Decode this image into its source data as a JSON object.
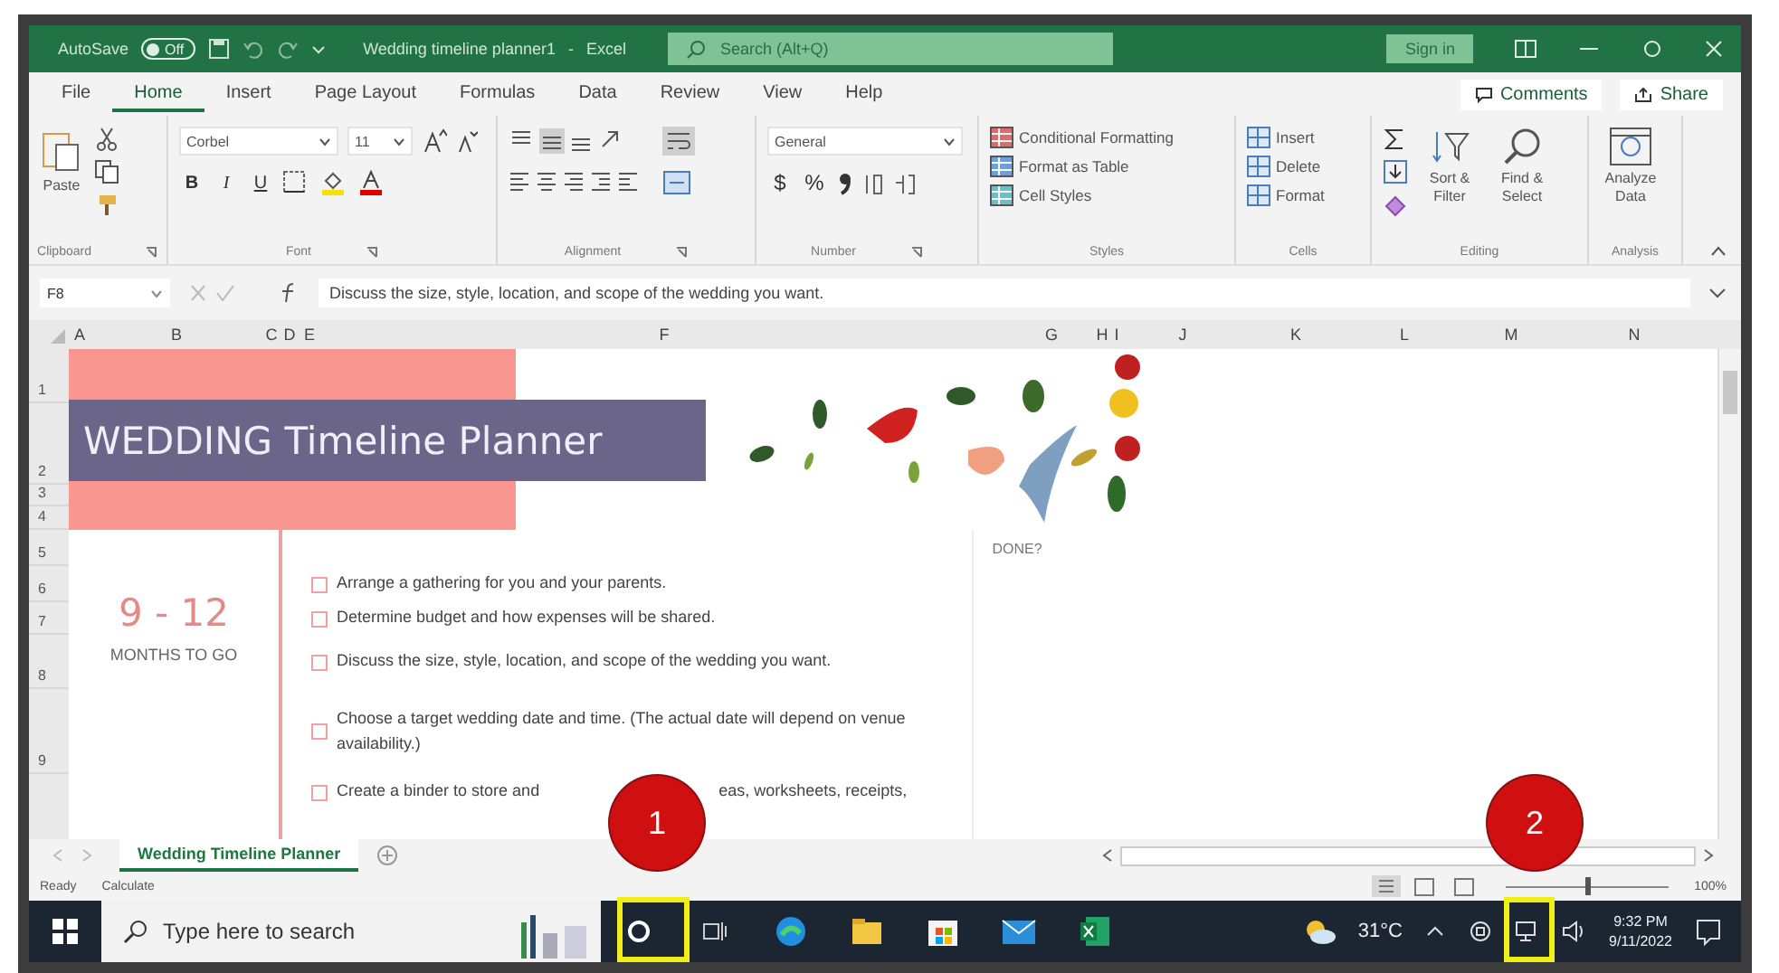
{
  "title_bar": {
    "autosave": {
      "label": "AutoSave",
      "on": false,
      "state_text": "Off"
    },
    "document_title": "Wedding timeline planner1",
    "separator": "-",
    "app_name": "Excel",
    "search_placeholder": "Search (Alt+Q)",
    "sign_in": "Sign in"
  },
  "ribbon_tabs": [
    {
      "label": "File",
      "selected": false
    },
    {
      "label": "Home",
      "selected": true
    },
    {
      "label": "Insert",
      "selected": false
    },
    {
      "label": "Page Layout",
      "selected": false
    },
    {
      "label": "Formulas",
      "selected": false
    },
    {
      "label": "Data",
      "selected": false
    },
    {
      "label": "Review",
      "selected": false
    },
    {
      "label": "View",
      "selected": false
    },
    {
      "label": "Help",
      "selected": false
    }
  ],
  "comments": "Comments",
  "share": "Share",
  "ribbon": {
    "clipboard": {
      "paste": "Paste",
      "group": "Clipboard"
    },
    "font": {
      "name": "Corbel",
      "size": "11",
      "bold": "B",
      "italic": "I",
      "underline": "U",
      "group": "Font"
    },
    "alignment": {
      "group": "Alignment"
    },
    "number": {
      "format": "General",
      "currency": "$",
      "percent": "%",
      "group": "Number"
    },
    "styles": {
      "items": [
        "Conditional Formatting",
        "Format as Table",
        "Cell Styles"
      ],
      "group": "Styles"
    },
    "cells": {
      "items": [
        "Insert",
        "Delete",
        "Format"
      ],
      "group": "Cells"
    },
    "editing": {
      "sort": "Sort & Filter",
      "find": "Find & Select",
      "group": "Editing"
    },
    "analysis": {
      "button": "Analyze Data",
      "group": "Analysis"
    }
  },
  "formula_bar": {
    "name_box": "F8",
    "formula": "Discuss the size, style, location, and scope of the wedding you want."
  },
  "sheet": {
    "columns": [
      "A",
      "B",
      "C",
      "D",
      "E",
      "F",
      "G",
      "H",
      "I",
      "J",
      "K",
      "L",
      "M",
      "N"
    ],
    "row_numbers": [
      "1",
      "2",
      "3",
      "4",
      "5",
      "6",
      "7",
      "8",
      "9"
    ],
    "title": "WEDDING Timeline Planner",
    "period": "9 - 12",
    "period_label": "MONTHS TO GO",
    "done_header": "DONE?",
    "tasks": [
      {
        "parts": [
          "Arrange a gathering for you and your parents."
        ],
        "checked": false
      },
      {
        "parts": [
          "Determine budget and how expenses will be shared."
        ],
        "checked": false
      },
      {
        "parts": [
          "Discuss the size, style, location, and scope of the wedding you want."
        ],
        "checked": false
      },
      {
        "parts": [
          "Choose a target wedding date and time. (The actual date will depend on venue availability.)"
        ],
        "checked": false
      },
      {
        "parts": [
          "Create a binder to store and",
          "eas, worksheets, receipts,"
        ],
        "checked": false
      }
    ],
    "sheet_tab": {
      "label": "Wedding Timeline Planner",
      "selected": true
    }
  },
  "status_bar": {
    "ready": "Ready",
    "calculate": "Calculate",
    "zoom": {
      "level": 0.5
    },
    "zoom_text": "100%"
  },
  "taskbar": {
    "search_placeholder": "Type here to search",
    "temperature": "31°C",
    "time": "9:32 PM",
    "date": "9/11/2022"
  },
  "callouts": [
    "1",
    "2"
  ]
}
